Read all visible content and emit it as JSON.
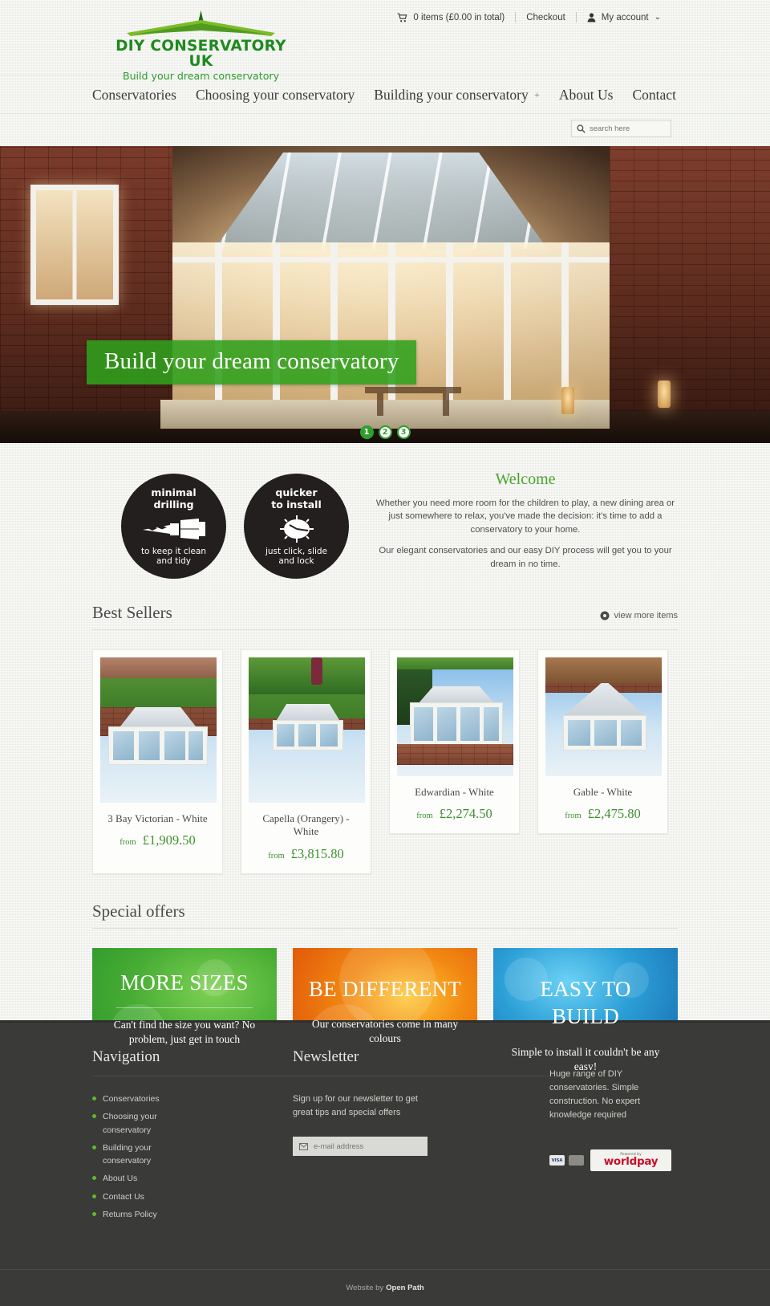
{
  "brand": {
    "name": "DIY CONSERVATORY UK",
    "tagline": "Build your dream conservatory",
    "color": "#1e8a1e"
  },
  "utilities": {
    "cart_icon": "shopping-cart-icon",
    "cart_label": "0 items (£0.00 in total)",
    "checkout_label": "Checkout",
    "account_icon": "user-icon",
    "account_label": "My account",
    "account_caret": "⌄"
  },
  "nav": {
    "items": [
      {
        "label": "Conservatories",
        "has_plus": false
      },
      {
        "label": "Choosing your conservatory",
        "has_plus": false
      },
      {
        "label": "Building your conservatory",
        "has_plus": true,
        "plus": "+"
      },
      {
        "label": "About Us",
        "has_plus": false
      },
      {
        "label": "Contact",
        "has_plus": false
      }
    ]
  },
  "search": {
    "icon": "search-icon",
    "placeholder": "search here",
    "value": ""
  },
  "hero": {
    "caption": "Build your dream conservatory",
    "slides": [
      {
        "number": "1",
        "active": true
      },
      {
        "number": "2",
        "active": false
      },
      {
        "number": "3",
        "active": false
      }
    ]
  },
  "badges": [
    {
      "top": "minimal\ndrilling",
      "top_line1": "minimal",
      "top_line2": "drilling",
      "icon": "drill-bit-icon",
      "bottom_line1": "to keep it clean",
      "bottom_line2": "and tidy"
    },
    {
      "top_line1": "quicker",
      "top_line2": "to install",
      "icon": "clock-icon",
      "bottom_line1": "just click, slide",
      "bottom_line2": "and lock"
    }
  ],
  "welcome": {
    "heading": "Welcome",
    "paragraph1": "Whether you need more room for the children to play, a new dining area or just somewhere to relax, you've made the decision: it's time to add a conservatory to your home.",
    "paragraph2": "Our elegant conservatories and our easy DIY process will get you to your dream in no time."
  },
  "best_sellers": {
    "heading": "Best Sellers",
    "more_icon": "eye-icon",
    "more_label": "view more items",
    "products": [
      {
        "name": "3 Bay Victorian - White",
        "from": "from",
        "price": "£1,909.50",
        "style": "bay"
      },
      {
        "name": "Capella (Orangery) - White",
        "from": "from",
        "price": "£3,815.80",
        "style": "orangery"
      },
      {
        "name": "Edwardian - White",
        "from": "from",
        "price": "£2,274.50",
        "style": "edwardian"
      },
      {
        "name": "Gable - White",
        "from": "from",
        "price": "£2,475.80",
        "style": "gable"
      }
    ]
  },
  "special_offers": {
    "heading": "Special offers",
    "cards": [
      {
        "title": "MORE SIZES",
        "subtitle": "Can't find the size you want? No problem, just get in touch",
        "color": "#3fa52f",
        "theme": "green"
      },
      {
        "title": "BE DIFFERENT",
        "subtitle": "Our conservatories come in many colours",
        "color": "#ef7d10",
        "theme": "orange"
      },
      {
        "title": "EASY TO BUILD",
        "subtitle": "Simple to install it couldn't be any easy!",
        "color": "#2b9ed6",
        "theme": "blue"
      }
    ]
  },
  "footer": {
    "navigation": {
      "heading": "Navigation",
      "items": [
        "Conservatories",
        "Choosing your conservatory",
        "Building your conservatory",
        "About Us",
        "Contact Us",
        "Returns Policy"
      ]
    },
    "newsletter": {
      "heading": "Newsletter",
      "text": "Sign up for our newsletter to get great tips and special offers",
      "input_icon": "envelope-icon",
      "placeholder": "e-mail address",
      "value": ""
    },
    "about": {
      "text": "Huge range of DIY conservatories. Simple construction. No expert knowledge required",
      "payments": [
        {
          "name": "visa-card-icon",
          "label": "VISA"
        },
        {
          "name": "maestro-card-icon",
          "label": ""
        }
      ],
      "worldpay_small": "Powered by",
      "worldpay_main": "worldpay"
    },
    "credit": {
      "prefix": "Website by",
      "company": "Open Path"
    }
  }
}
